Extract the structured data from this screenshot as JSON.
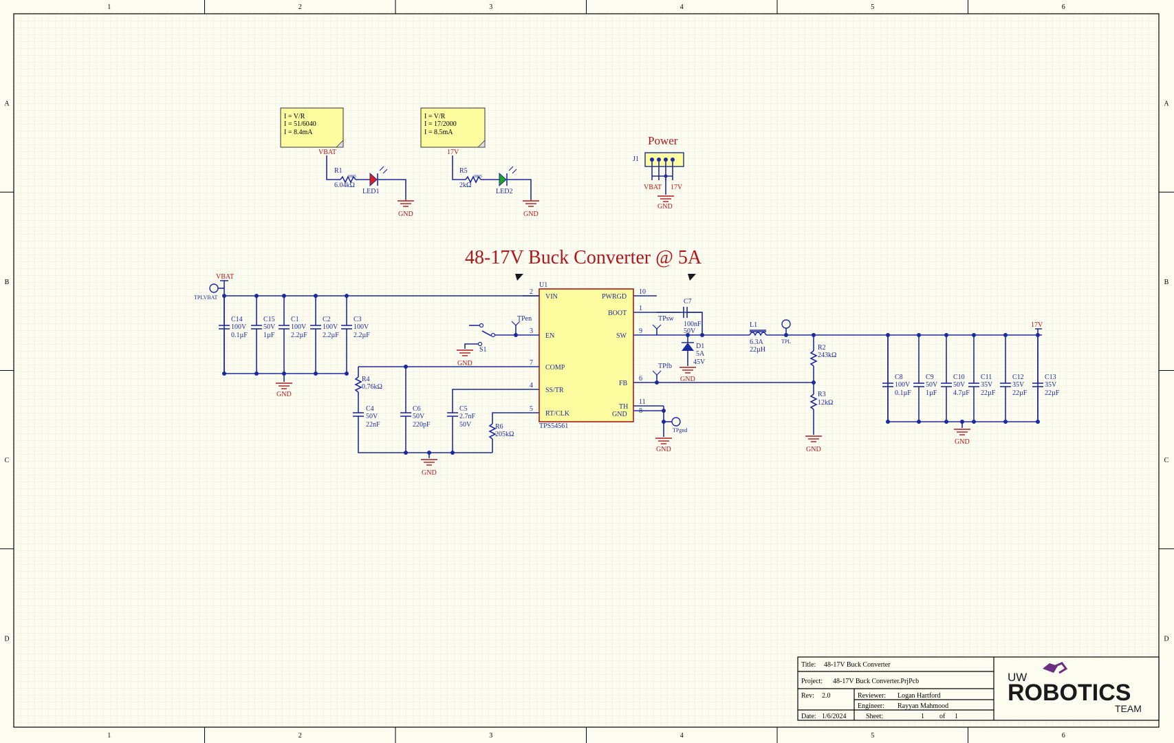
{
  "colors": {
    "wire": "#1b2a9e",
    "net": "#b0161a",
    "ic_fill": "#fdfda0",
    "background": "#fdfcf0",
    "led1": "#e01b1b",
    "led2": "#1ba81b"
  },
  "border": {
    "columns": [
      "1",
      "2",
      "3",
      "4",
      "5",
      "6"
    ],
    "rows": [
      "A",
      "B",
      "C",
      "D"
    ]
  },
  "title": "48-17V Buck Converter @ 5A",
  "power_label": "Power",
  "notes": [
    {
      "lines": [
        "I = V/R",
        "I = 51/6040",
        "I = 8.4mA"
      ]
    },
    {
      "lines": [
        "I = V/R",
        "I = 17/2000",
        "I = 8.5mA"
      ]
    }
  ],
  "nets": {
    "vbat": "VBAT",
    "v17": "17V",
    "gnd": "GND"
  },
  "parts": {
    "r1": {
      "ref": "R1",
      "value": "6.04kΩ",
      "pkg": "0805"
    },
    "r5": {
      "ref": "R5",
      "value": "2kΩ",
      "pkg": "0805"
    },
    "led1": "LED1",
    "led2": "LED2",
    "j1": "J1",
    "u1": {
      "ref": "U1",
      "part": "TPS54561",
      "pins_left": [
        {
          "num": "2",
          "name": "VIN"
        },
        {
          "num": "3",
          "name": "EN"
        },
        {
          "num": "7",
          "name": "COMP"
        },
        {
          "num": "4",
          "name": "SS/TR"
        },
        {
          "num": "5",
          "name": "RT/CLK"
        }
      ],
      "pins_right": [
        {
          "num": "10",
          "name": "PWRGD"
        },
        {
          "num": "1",
          "name": "BOOT"
        },
        {
          "num": "9",
          "name": "SW"
        },
        {
          "num": "6",
          "name": "FB"
        },
        {
          "num": "11",
          "name": "TH"
        },
        {
          "num": "8",
          "name": "GND"
        }
      ]
    },
    "c14": {
      "ref": "C14",
      "v": "100V",
      "val": "0.1µF"
    },
    "c15": {
      "ref": "C15",
      "v": "50V",
      "val": "1µF"
    },
    "c1": {
      "ref": "C1",
      "v": "100V",
      "val": "2.2µF"
    },
    "c2": {
      "ref": "C2",
      "v": "100V",
      "val": "2.2µF"
    },
    "c3": {
      "ref": "C3",
      "v": "100V",
      "val": "2.2µF"
    },
    "c7": {
      "ref": "C7",
      "val": "100nF",
      "v": "50V"
    },
    "d1": {
      "ref": "D1",
      "a": "5A",
      "v": "45V"
    },
    "l1": {
      "ref": "L1",
      "a": "6.3A",
      "val": "22µH"
    },
    "r2": {
      "ref": "R2",
      "val": "243kΩ"
    },
    "r3": {
      "ref": "R3",
      "val": "12kΩ"
    },
    "r4": {
      "ref": "R4",
      "val": "0.76kΩ"
    },
    "r6": {
      "ref": "R6",
      "val": "205kΩ"
    },
    "c4": {
      "ref": "C4",
      "v": "50V",
      "val": "22nF"
    },
    "c6": {
      "ref": "C6",
      "v": "50V",
      "val": "220pF"
    },
    "c5": {
      "ref": "C5",
      "val": "2.7nF",
      "v": "50V"
    },
    "c8": {
      "ref": "C8",
      "v": "100V",
      "val": "0.1µF"
    },
    "c9": {
      "ref": "C9",
      "v": "50V",
      "val": "1µF"
    },
    "c10": {
      "ref": "C10",
      "v": "50V",
      "val": "4.7µF"
    },
    "c11": {
      "ref": "C11",
      "v": "35V",
      "val": "22µF"
    },
    "c12": {
      "ref": "C12",
      "v": "35V",
      "val": "22µF"
    },
    "c13": {
      "ref": "C13",
      "v": "35V",
      "val": "22µF"
    },
    "s1": "S1",
    "tp": {
      "vbat": "TPLVBAT",
      "en": "TPen",
      "sw": "TPsw",
      "fb": "TPfb",
      "gnd": "TPgnd",
      "l": "TPL"
    }
  },
  "title_block": {
    "title_label": "Title:",
    "title": "48-17V Buck Converter",
    "project_label": "Project:",
    "project": "48-17V Buck Converter.PrjPcb",
    "rev_label": "Rev:",
    "rev": "2.0",
    "reviewer_label": "Reviewer:",
    "reviewer": "Logan Hartford",
    "engineer_label": "Engineer:",
    "engineer": "Rayyan Mahmood",
    "date_label": "Date:",
    "date": "1/6/2024",
    "sheet_label": "Sheet:",
    "sheet": "1",
    "of_label": "of",
    "sheet_total": "1",
    "logo_top": "UW",
    "logo_main": "ROBOTICS",
    "logo_bottom": "TEAM"
  }
}
